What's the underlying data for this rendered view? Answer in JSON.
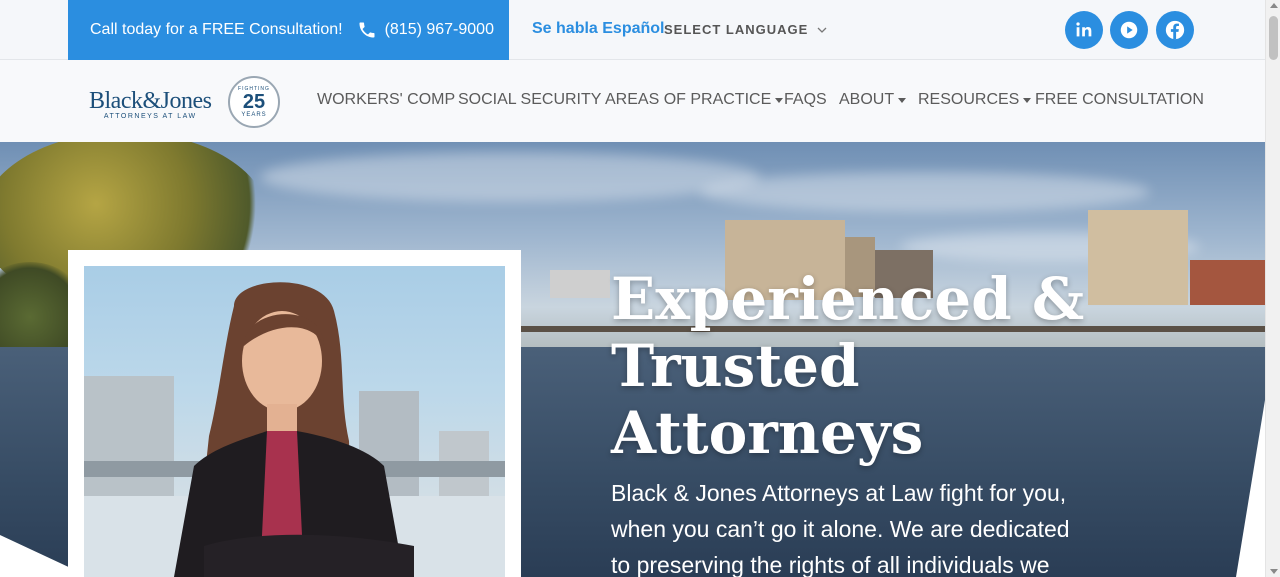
{
  "topbar": {
    "call_text": "Call today for a FREE Consultation!",
    "phone": "(815) 967-9000",
    "habla": "Se habla Español",
    "language": "SELECT LANGUAGE"
  },
  "social": {
    "icons": [
      "linkedin-icon",
      "youtube-icon",
      "facebook-icon"
    ],
    "accent_color": "#2b8ee0"
  },
  "logo": {
    "name": "Black&Jones",
    "tagline": "ATTORNEYS AT LAW",
    "badge_number": "25",
    "badge_top": "FIGHTING",
    "badge_bottom": "YEARS"
  },
  "nav": {
    "items": [
      {
        "label": "WORKERS' COMP"
      },
      {
        "label": "SOCIAL SECURITY"
      },
      {
        "label": "AREAS OF PRACTICE"
      },
      {
        "label": "FAQS"
      },
      {
        "label": "ABOUT"
      },
      {
        "label": "RESOURCES"
      },
      {
        "label": "FREE CONSULTATION"
      }
    ]
  },
  "hero": {
    "headline_line1": "Experienced &",
    "headline_line2": "Trusted",
    "headline_line3": "Attorneys",
    "subtext": "Black & Jones Attorneys at Law fight for you, when you can’t go it alone. We are dedicated to preserving the rights of all individuals we"
  }
}
